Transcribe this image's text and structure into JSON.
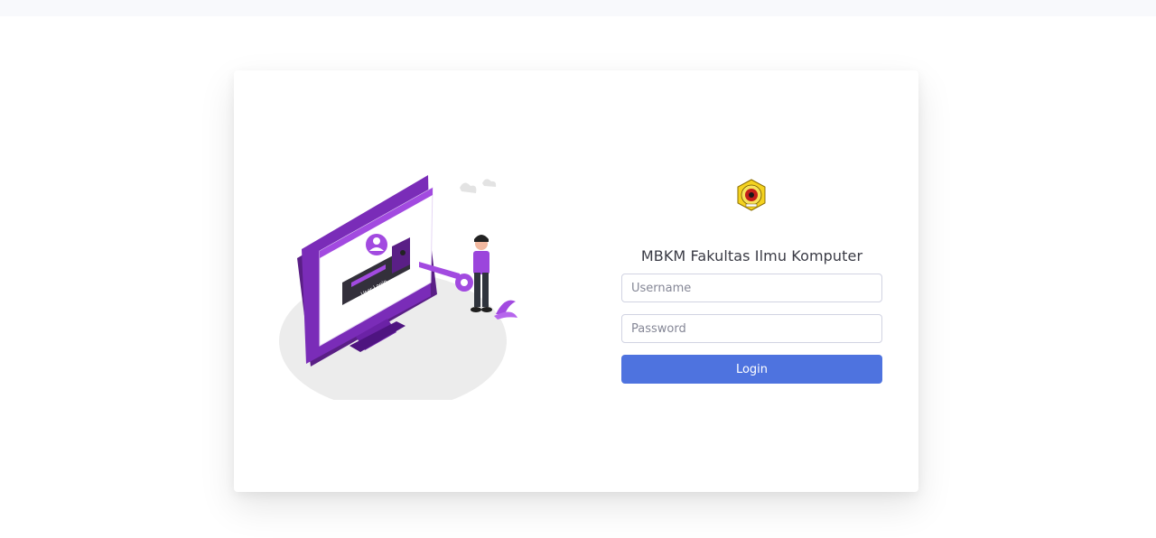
{
  "login": {
    "title": "MBKM Fakultas Ilmu Komputer",
    "username_placeholder": "Username",
    "password_placeholder": "Password",
    "login_label": "Login"
  },
  "illustration": {
    "screen_text": "User Login"
  },
  "colors": {
    "accent": "#4e73df",
    "illustration_purple": "#8e3fd1",
    "logo_yellow": "#f4d21f",
    "logo_red": "#c4201a"
  }
}
